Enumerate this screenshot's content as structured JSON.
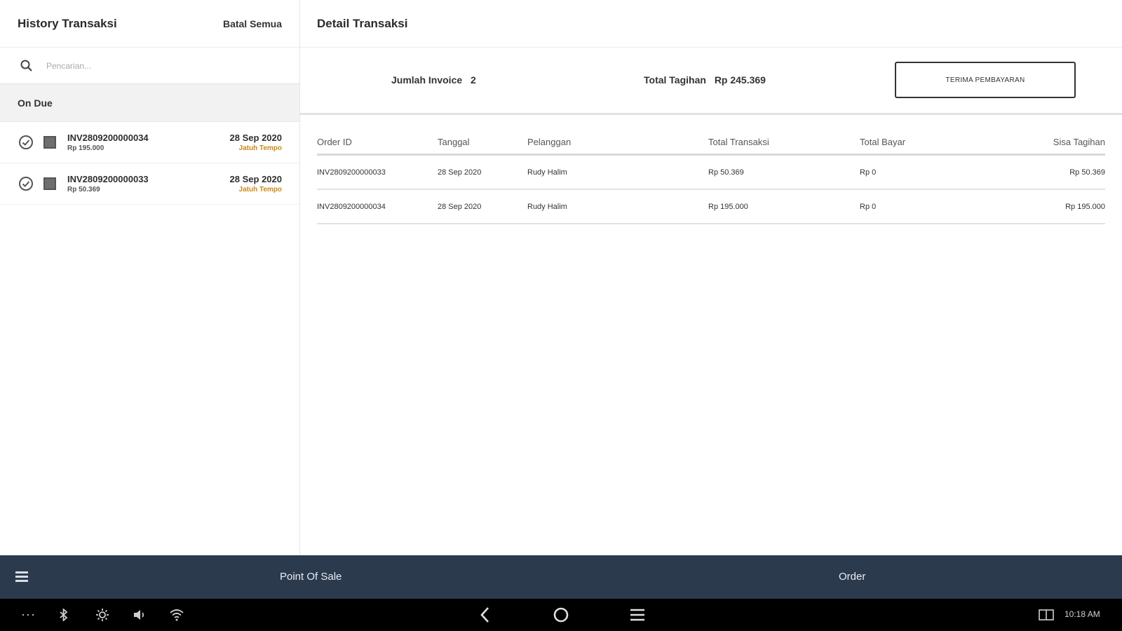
{
  "left": {
    "title": "History Transaksi",
    "cancel_all": "Batal Semua",
    "search_placeholder": "Pencarian...",
    "section": "On Due",
    "items": [
      {
        "id": "INV2809200000034",
        "amount": "Rp 195.000",
        "date": "28 Sep 2020",
        "status": "Jatuh Tempo"
      },
      {
        "id": "INV2809200000033",
        "amount": "Rp 50.369",
        "date": "28 Sep 2020",
        "status": "Jatuh Tempo"
      }
    ]
  },
  "right": {
    "title": "Detail Transaksi",
    "count_label": "Jumlah Invoice",
    "count_value": "2",
    "total_label": "Total Tagihan",
    "total_value": "Rp 245.369",
    "receive_button": "TERIMA PEMBAYARAN",
    "columns": [
      "Order ID",
      "Tanggal",
      "Pelanggan",
      "Total Transaksi",
      "Total Bayar",
      "Sisa Tagihan"
    ],
    "rows": [
      [
        "INV2809200000033",
        "28 Sep 2020",
        "Rudy Halim",
        "Rp 50.369",
        "Rp 0",
        "Rp 50.369"
      ],
      [
        "INV2809200000034",
        "28 Sep 2020",
        "Rudy Halim",
        "Rp 195.000",
        "Rp 0",
        "Rp 195.000"
      ]
    ]
  },
  "appbar": {
    "item1": "Point Of Sale",
    "item2": "Order"
  },
  "system": {
    "time": "10:18 AM",
    "icons": [
      "more-icon",
      "bluetooth-icon",
      "brightness-icon",
      "volume-icon",
      "wifi-icon",
      "back-icon",
      "home-icon",
      "recents-icon",
      "keyboard-icon"
    ]
  }
}
